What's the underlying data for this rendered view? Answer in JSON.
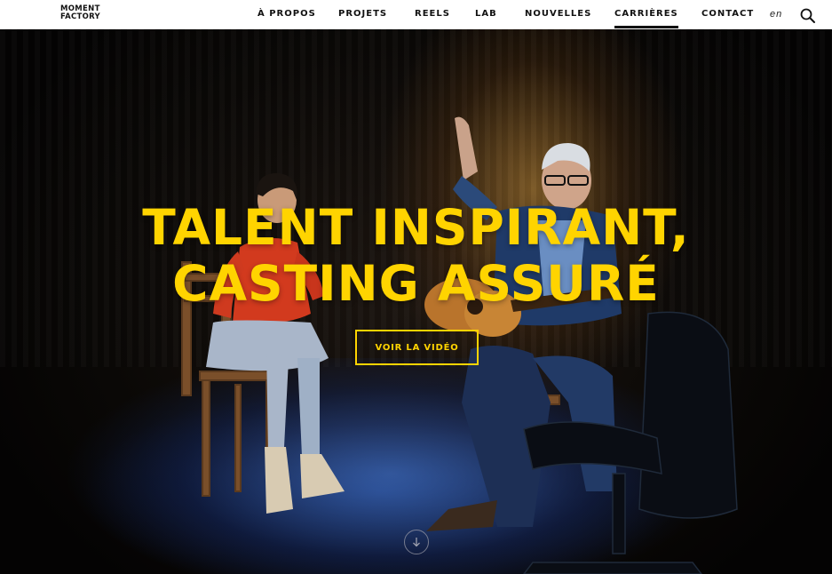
{
  "brand": {
    "line1": "MOMENT",
    "line2": "FACTORY"
  },
  "nav": {
    "items": [
      {
        "label": "À PROPOS"
      },
      {
        "label": "PROJETS"
      },
      {
        "label": "REELS"
      },
      {
        "label": "LAB"
      },
      {
        "label": "NOUVELLES"
      },
      {
        "label": "CARRIÈRES",
        "active": true
      },
      {
        "label": "CONTACT"
      }
    ],
    "language": "en",
    "search_icon": "search-icon"
  },
  "hero": {
    "headline_line1": "TALENT INSPIRANT,",
    "headline_line2": "CASTING ASSURÉ",
    "cta_label": "VOIR LA VIDÉO",
    "scroll_icon": "arrow-down-circle-icon"
  },
  "colors": {
    "accent": "#ffd400",
    "header_bg": "#ffffff",
    "nav_text": "#111111"
  }
}
